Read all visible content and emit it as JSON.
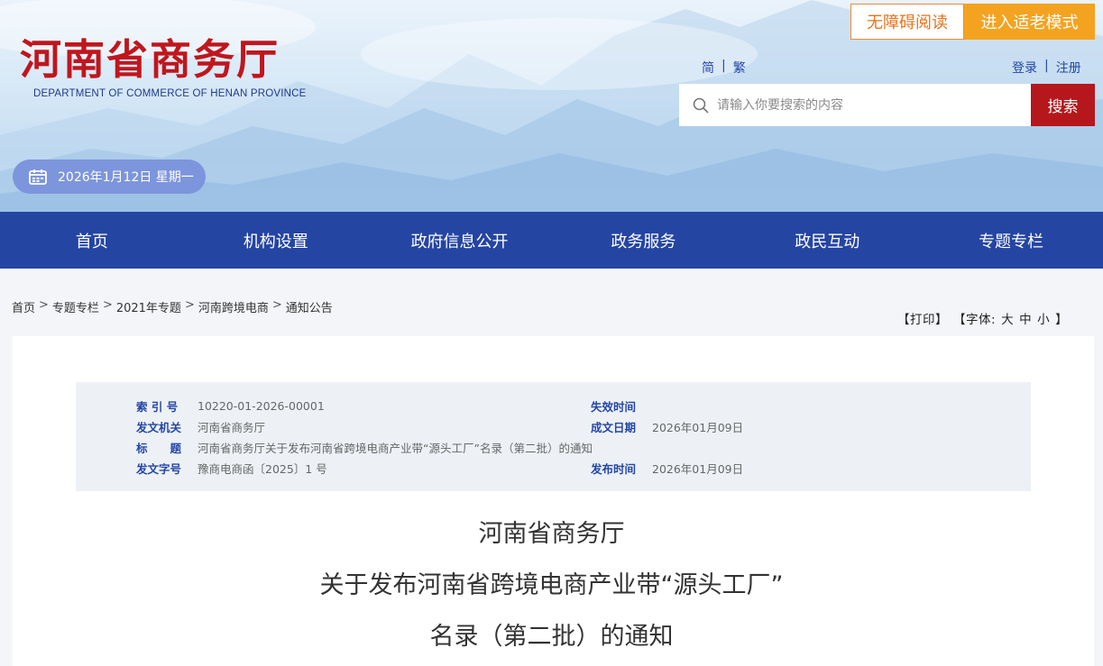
{
  "header": {
    "logo_title": "河南省商务厅",
    "logo_subtitle": "DEPARTMENT OF COMMERCE OF HENAN PROVINCE",
    "date_text": "2026年1月12日 星期一",
    "accessibility_label": "无障碍阅读",
    "elder_mode_label": "进入适老模式",
    "lang_simplified": "简",
    "lang_traditional": "繁",
    "divider": "|",
    "login_label": "登录",
    "register_label": "注册",
    "search_placeholder": "请输入你要搜索的内容",
    "search_button": "搜索"
  },
  "nav": {
    "items": [
      "首页",
      "机构设置",
      "政府信息公开",
      "政务服务",
      "政民互动",
      "专题专栏"
    ]
  },
  "breadcrumb": {
    "items": [
      "首页",
      "专题专栏",
      "2021年专题",
      "河南跨境电商",
      "通知公告"
    ],
    "separator": ">"
  },
  "tools": {
    "print": "【打印】",
    "font_label": "【字体:",
    "large": "大",
    "medium": "中",
    "small": "小",
    "close": "】"
  },
  "meta": {
    "index_label": "索 引 号",
    "index_value": "10220-01-2026-00001",
    "expire_label": "失效时间",
    "expire_value": "",
    "issuer_label": "发文机关",
    "issuer_value": "河南省商务厅",
    "created_label": "成文日期",
    "created_value": "2026年01月09日",
    "title_label": "标　　题",
    "title_value": "河南省商务厅关于发布河南省跨境电商产业带“源头工厂”名录（第二批）的通知",
    "docno_label": "发文字号",
    "docno_value": "豫商电商函〔2025〕1 号",
    "published_label": "发布时间",
    "published_value": "2026年01月09日"
  },
  "document": {
    "title_line1": "河南省商务厅",
    "title_line2": "关于发布河南省跨境电商产业带“源头工厂”",
    "title_line3": "名录（第二批）的通知"
  },
  "colors": {
    "brand_red": "#c0161d",
    "nav_blue": "#2545a3",
    "accent_orange": "#f4a320",
    "search_red": "#b5171d"
  }
}
